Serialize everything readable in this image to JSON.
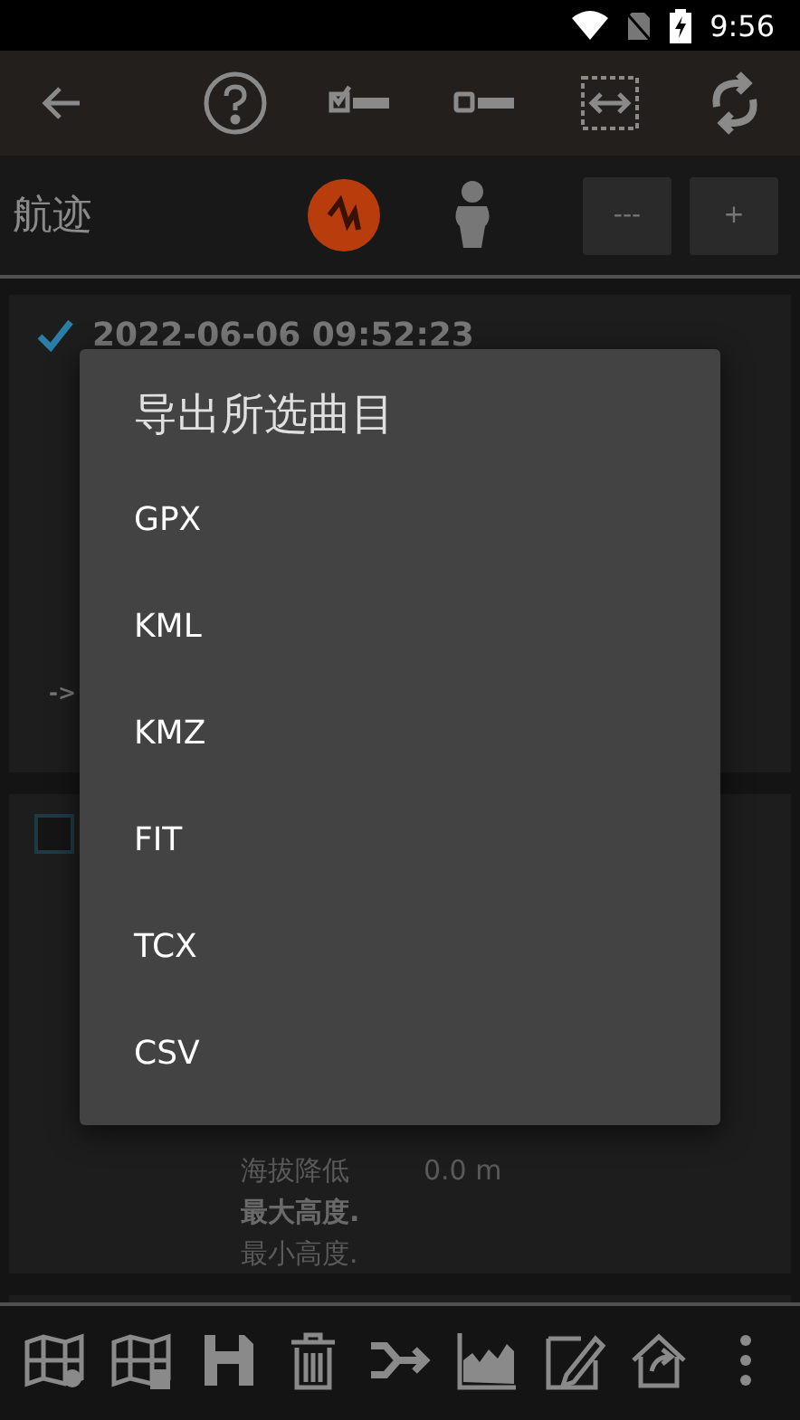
{
  "status_bar": {
    "time": "9:56"
  },
  "header": {
    "title": "航迹",
    "buttons": [
      "---",
      "+"
    ]
  },
  "tracks": [
    {
      "checked": true,
      "date": "2022-06-06 09:52:23",
      "arrow": "->"
    },
    {
      "checked": false,
      "stats": [
        {
          "label": "海拔降低",
          "value": "0.0 m",
          "bold": false
        },
        {
          "label": "最大高度.",
          "bold": true
        },
        {
          "label": "最小高度.",
          "bold": false
        }
      ]
    }
  ],
  "dialog": {
    "title": "导出所选曲目",
    "options": [
      "GPX",
      "KML",
      "KMZ",
      "FIT",
      "TCX",
      "CSV"
    ]
  }
}
